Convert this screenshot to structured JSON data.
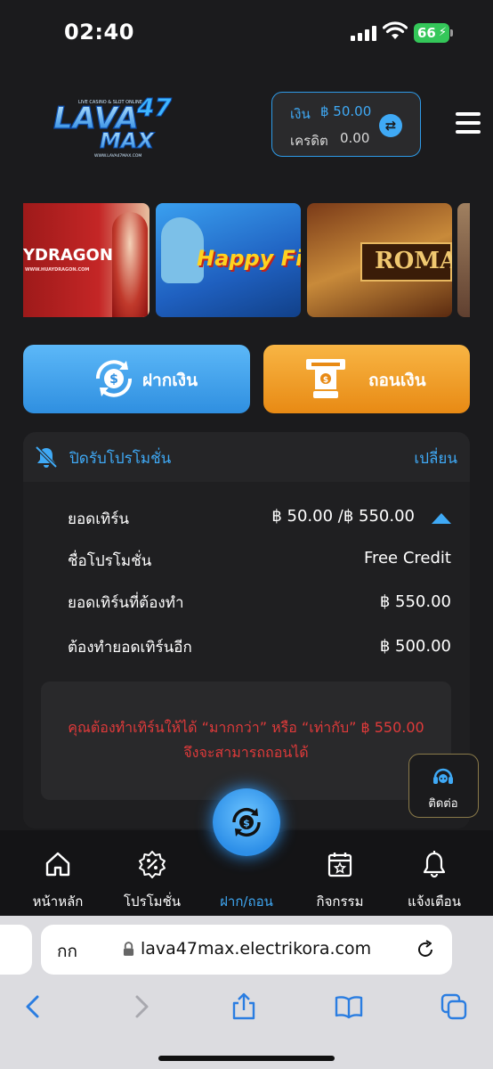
{
  "status_bar": {
    "time": "02:40",
    "battery": "66"
  },
  "header": {
    "logo_text": "LAVA47 MAX",
    "logo_tagline": "LIVE CASINO & SLOT ONLINE",
    "logo_url": "WWW.LAVA47MAX.COM",
    "balance_label": "เงิน",
    "balance_value": "฿ 50.00",
    "credit_label": "เครดิต",
    "credit_value": "0.00"
  },
  "banners": [
    {
      "text": "YDRAGON",
      "sub": "WWW.HUAYDRAGON.COM"
    },
    {
      "text": "Happy Fis"
    },
    {
      "text": "ROMA"
    }
  ],
  "actions": {
    "deposit_label": "ฝากเงิน",
    "withdraw_label": "ถอนเงิน"
  },
  "promo": {
    "title": "ปิดรับโปรโมชั่น",
    "change_label": "เปลี่ยน",
    "rows": [
      {
        "label": "ยอดเทิร์น",
        "value": "฿ 50.00 /฿ 550.00"
      },
      {
        "label": "ชื่อโปรโมชั่น",
        "value": "Free Credit"
      },
      {
        "label": "ยอดเทิร์นที่ต้องทำ",
        "value": "฿ 550.00"
      },
      {
        "label": "ต้องทำยอดเทิร์นอีก",
        "value": "฿ 500.00"
      }
    ],
    "warning": "คุณต้องทำเทิร์นให้ได้ “มากกว่า” หรือ “เท่ากับ” ฿ 550.00 จึงจะสามารถถอนได้"
  },
  "contact": {
    "label": "ติดต่อ"
  },
  "nav": {
    "items": [
      {
        "label": "หน้าหลัก",
        "icon": "home-icon"
      },
      {
        "label": "โปรโมชั่น",
        "icon": "promotion-icon"
      },
      {
        "label": "ฝาก/ถอน",
        "icon": "deposit-withdraw-icon"
      },
      {
        "label": "กิจกรรม",
        "icon": "calendar-icon"
      },
      {
        "label": "แจ้งเตือน",
        "icon": "bell-icon"
      }
    ],
    "active_index": 2
  },
  "browser": {
    "text_size_label": "กก",
    "url": "lava47max.electrikora.com"
  },
  "colors": {
    "accent": "#3fa9f5",
    "deposit": "#3a9bea",
    "withdraw": "#f0a02c",
    "warning": "#e03a3a",
    "background": "#1b1b1d"
  }
}
